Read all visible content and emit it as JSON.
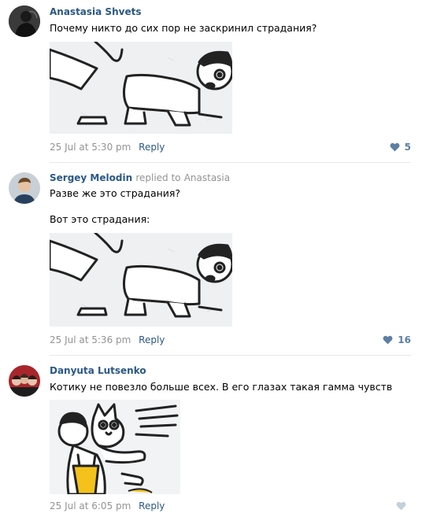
{
  "comments": [
    {
      "author": "Anastasia Shvets",
      "text": "Почему никто до сих пор не заскринил страдания?",
      "time": "25 Jul at 5:30 pm",
      "reply_label": "Reply",
      "likes": "5",
      "image_icon": "comic-strip-man-crawling"
    },
    {
      "author": "Sergey Melodin",
      "replied_text": "replied to",
      "replied_to": "Anastasia",
      "text_line1": "Разве же это страдания?",
      "text_line2": "Вот это страдания:",
      "time": "25 Jul at 5:36 pm",
      "reply_label": "Reply",
      "likes": "16",
      "image_icon": "comic-strip-man-crawling"
    },
    {
      "author": "Danyuta Lutsenko",
      "text": "Котику не повезло больше всех. В его глазах такая гамма чувств",
      "time": "25 Jul at 6:05 pm",
      "reply_label": "Reply",
      "likes": "",
      "image_icon": "comic-strip-cat-grabbed"
    }
  ],
  "colors": {
    "link": "#2a5885",
    "meta": "#939393",
    "like": "#5d7fa3",
    "divider": "#e7e8ec"
  }
}
